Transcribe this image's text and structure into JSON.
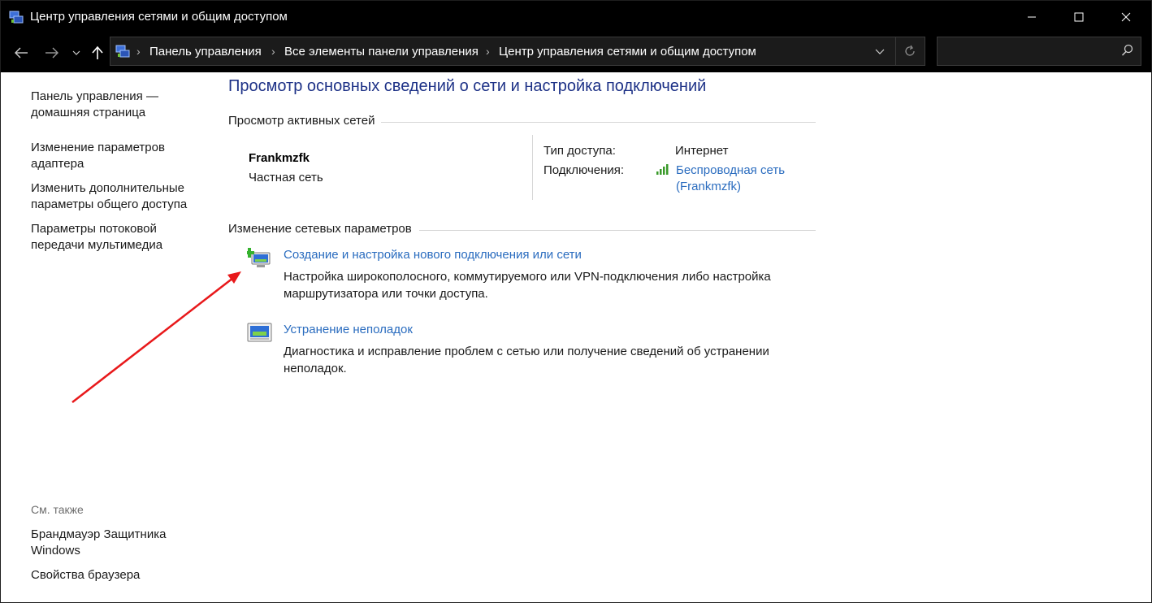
{
  "window": {
    "title": "Центр управления сетями и общим доступом"
  },
  "address_bar": {
    "crumbs": [
      "Панель управления",
      "Все элементы панели управления",
      "Центр управления сетями и общим доступом"
    ],
    "search_placeholder": ""
  },
  "sidebar": {
    "home_link": "Панель управления — домашняя страница",
    "links": [
      "Изменение параметров адаптера",
      "Изменить дополнительные параметры общего доступа",
      "Параметры потоковой передачи мультимедиа"
    ],
    "see_also_label": "См. также",
    "see_also": [
      "Брандмауэр Защитника Windows",
      "Свойства браузера"
    ]
  },
  "main": {
    "title": "Просмотр основных сведений о сети и настройка подключений",
    "active_networks": {
      "header": "Просмотр активных сетей",
      "network_name": "Frankmzfk",
      "network_category": "Частная сеть",
      "access_type_label": "Тип доступа:",
      "access_type_value": "Интернет",
      "connections_label": "Подключения:",
      "connection_value": "Беспроводная сеть (Frankmzfk)"
    },
    "change_settings": {
      "header": "Изменение сетевых параметров",
      "tasks": [
        {
          "link": "Создание и настройка нового подключения или сети",
          "description": "Настройка широкополосного, коммутируемого или VPN-подключения либо настройка маршрутизатора или точки доступа.",
          "icon": "new-connection-icon"
        },
        {
          "link": "Устранение неполадок",
          "description": "Диагностика и исправление проблем с сетью или получение сведений об устранении неполадок.",
          "icon": "troubleshoot-icon"
        }
      ]
    }
  },
  "colors": {
    "title_blue": "#1e3287",
    "link_blue": "#2a6cbf",
    "annotation_red": "#e8191b"
  }
}
